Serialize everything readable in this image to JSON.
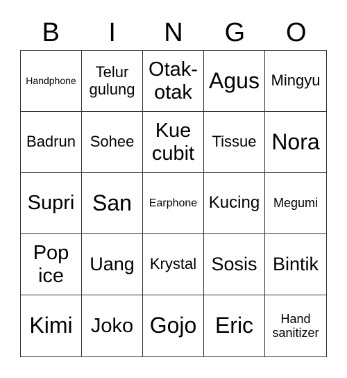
{
  "header": [
    "B",
    "I",
    "N",
    "G",
    "O"
  ],
  "cells": [
    "Handphone",
    "Telur gulung",
    "Otak-otak",
    "Agus",
    "Mingyu",
    "Badrun",
    "Sohee",
    "Kue cubit",
    "Tissue",
    "Nora",
    "Supri",
    "San",
    "Earphone",
    "Kucing",
    "Megumi",
    "Pop ice",
    "Uang",
    "Krystal",
    "Sosis",
    "Bintik",
    "Kimi",
    "Joko",
    "Gojo",
    "Eric",
    "Hand sanitizer"
  ]
}
